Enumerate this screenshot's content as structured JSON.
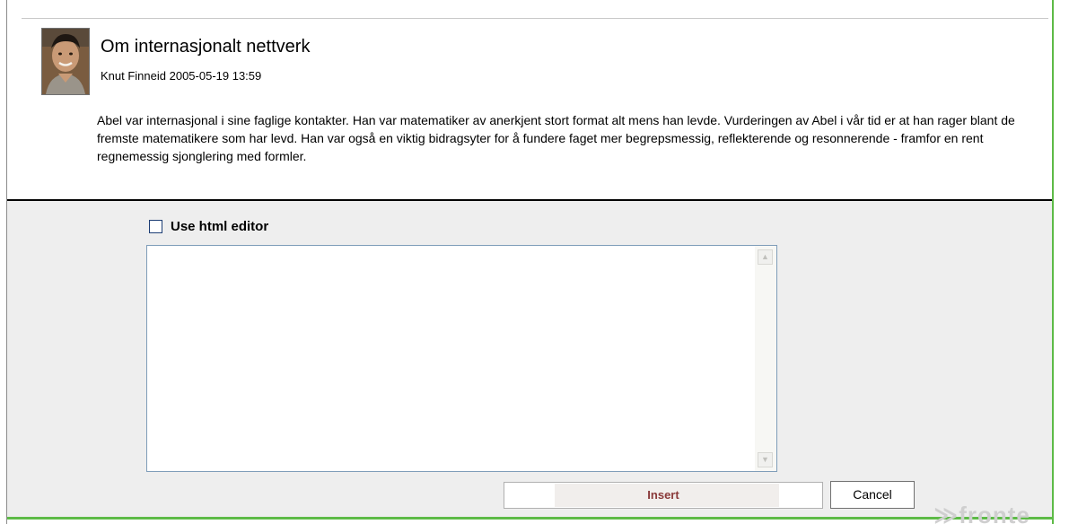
{
  "post": {
    "title": "Om internasjonalt nettverk",
    "author_line": "Knut Finneid 2005-05-19 13:59",
    "body": "Abel var internasjonal i sine faglige kontakter. Han var matematiker av anerkjent stort format alt mens han levde. Vurderingen av Abel i vår tid er at han rager blant de fremste matematikere som har levd. Han var også en viktig bidragsyter for å fundere faget mer begrepsmessig, reflekterende og resonnerende - framfor en rent regnemessig sjonglering med formler."
  },
  "reply": {
    "html_editor_label": "Use html editor",
    "html_editor_checked": false,
    "textarea_value": "",
    "insert_label": "Insert",
    "cancel_label": "Cancel"
  },
  "watermark": "≫fronte",
  "icons": {
    "scroll_up": "scroll-up-arrow-icon",
    "scroll_down": "scroll-down-arrow-icon"
  },
  "colors": {
    "accent_green": "#5dbb47",
    "reply_background": "#eeeeee",
    "insert_text": "#8a3a3a"
  }
}
